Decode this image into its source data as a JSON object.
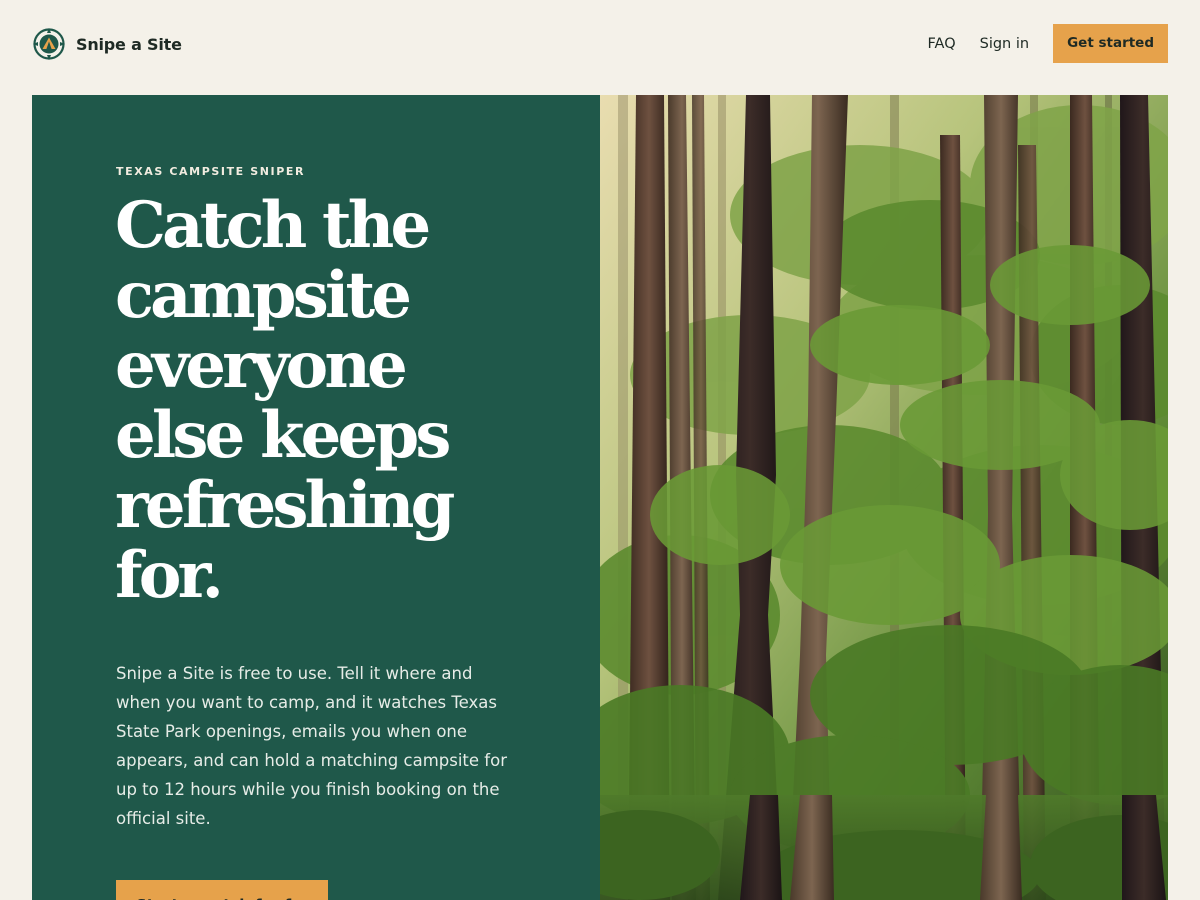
{
  "header": {
    "brand": {
      "name": "Snipe a Site",
      "logo_icon": "compass-tent-logo"
    },
    "nav": {
      "faq_label": "FAQ",
      "signin_label": "Sign in",
      "cta_label": "Get started"
    }
  },
  "hero": {
    "eyebrow": "TEXAS CAMPSITE SNIPER",
    "headline": "Catch the campsite everyone else keeps refreshing for.",
    "body": "Snipe a Site is free to use. Tell it where and when you want to camp, and it watches Texas State Park openings, emails you when one appears, and can hold a matching campsite for up to 12 hours while you finish booking on the official site.",
    "cta_label": "Start a watch for free",
    "photo_subject": "forest-tree-trunks-photo"
  },
  "colors": {
    "page_bg": "#f4f1e9",
    "panel_green": "#1f584a",
    "accent_orange": "#e6a24b",
    "text_dark": "#1e2a24",
    "text_light": "#ffffff"
  }
}
